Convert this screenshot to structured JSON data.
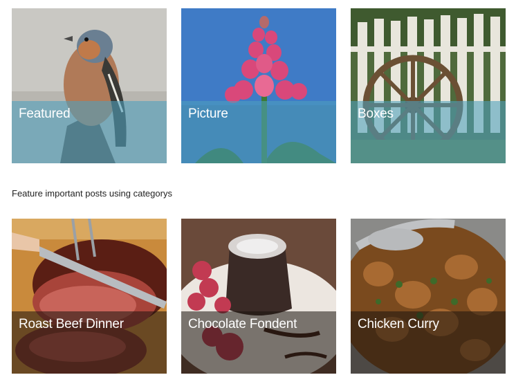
{
  "top_tiles": [
    {
      "title": "Featured",
      "image": "bird-photo"
    },
    {
      "title": "Picture",
      "image": "lupin-flower-photo"
    },
    {
      "title": "Boxes",
      "image": "wagon-wheel-fence-photo"
    }
  ],
  "caption": "Feature important posts using categorys",
  "bottom_tiles": [
    {
      "title": "Roast Beef Dinner",
      "image": "roast-beef-photo"
    },
    {
      "title": "Chocolate Fondent",
      "image": "chocolate-fondant-photo"
    },
    {
      "title": "Chicken Curry",
      "image": "chicken-curry-photo"
    }
  ],
  "colors": {
    "band_blue": "#4ea0be",
    "band_dark": "#1c140e"
  }
}
